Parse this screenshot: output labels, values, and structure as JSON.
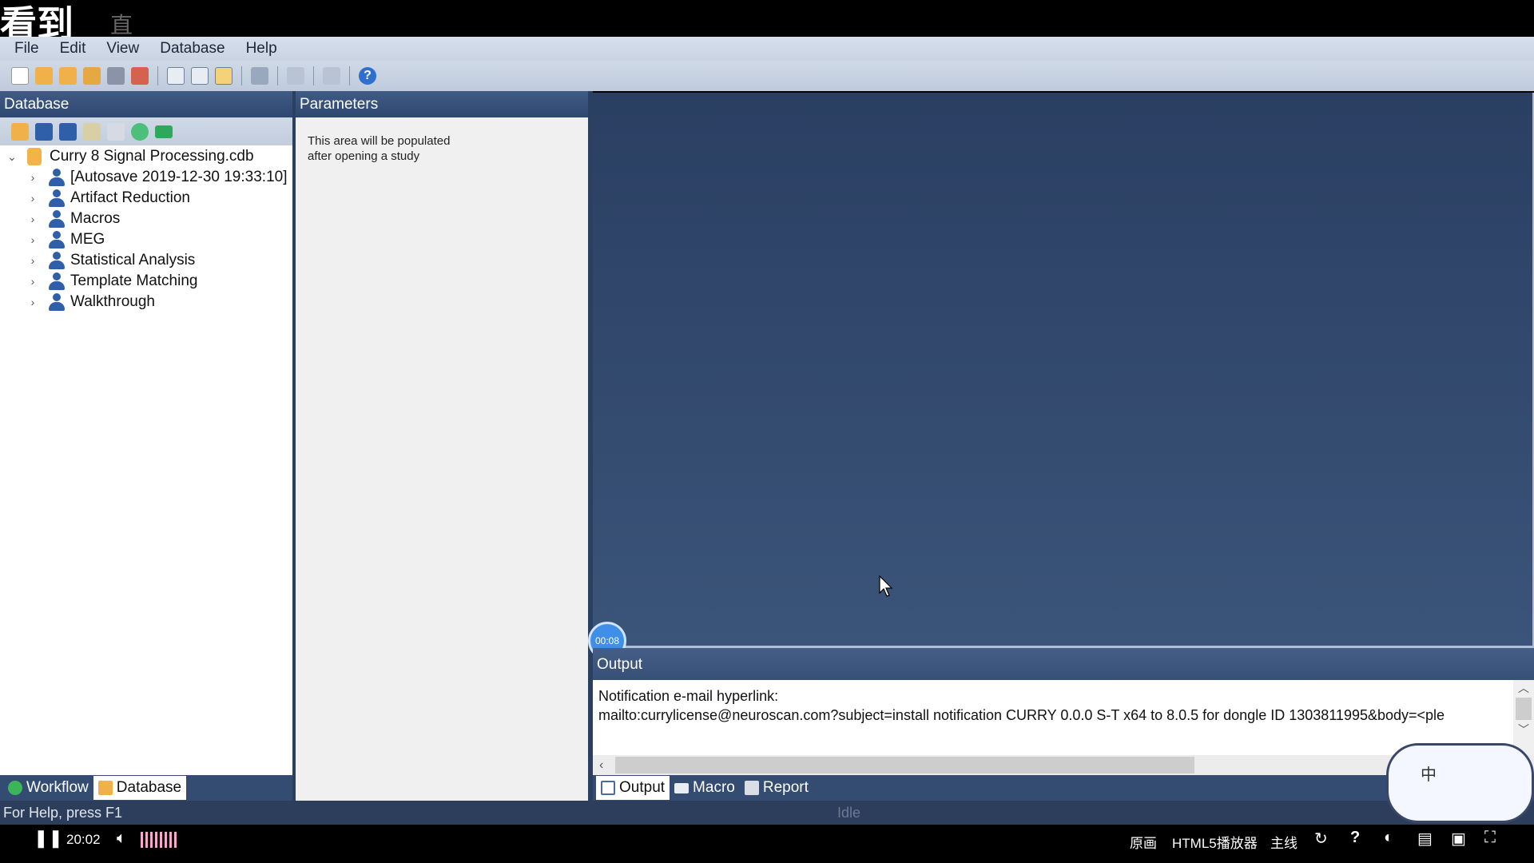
{
  "overlay": {
    "watermark": "看到",
    "watermark2": "直播"
  },
  "menu": [
    "File",
    "Edit",
    "View",
    "Database",
    "Help"
  ],
  "database_panel": {
    "title": "Database",
    "root": "Curry 8 Signal Processing.cdb",
    "items": [
      "[Autosave 2019-12-30 19:33:10]",
      "Artifact Reduction",
      "Macros",
      "MEG",
      "Statistical Analysis",
      "Template Matching",
      "Walkthrough"
    ]
  },
  "parameters_panel": {
    "title": "Parameters",
    "message": "This area will be populated after opening a study"
  },
  "viewer": {
    "timer": "00:08"
  },
  "output": {
    "title": "Output",
    "lines": [
      "Notification e-mail hyperlink:",
      "mailto:currylicense@neuroscan.com?subject=install notification CURRY 0.0.0 S-T x64 to 8.0.5 for dongle ID 1303811995&body=<ple"
    ]
  },
  "output_tabs": [
    "Output",
    "Macro",
    "Report"
  ],
  "left_tabs": [
    "Workflow",
    "Database"
  ],
  "status": {
    "help": "For Help, press F1",
    "state": "Idle"
  },
  "player": {
    "time": "20:02",
    "original": "原画",
    "html5": "HTML5播放器",
    "line": "主线"
  },
  "colors": {
    "panel_header": "#3a5278",
    "viewer_bg": "#2f4568",
    "status_bg": "#2c3e5c"
  }
}
